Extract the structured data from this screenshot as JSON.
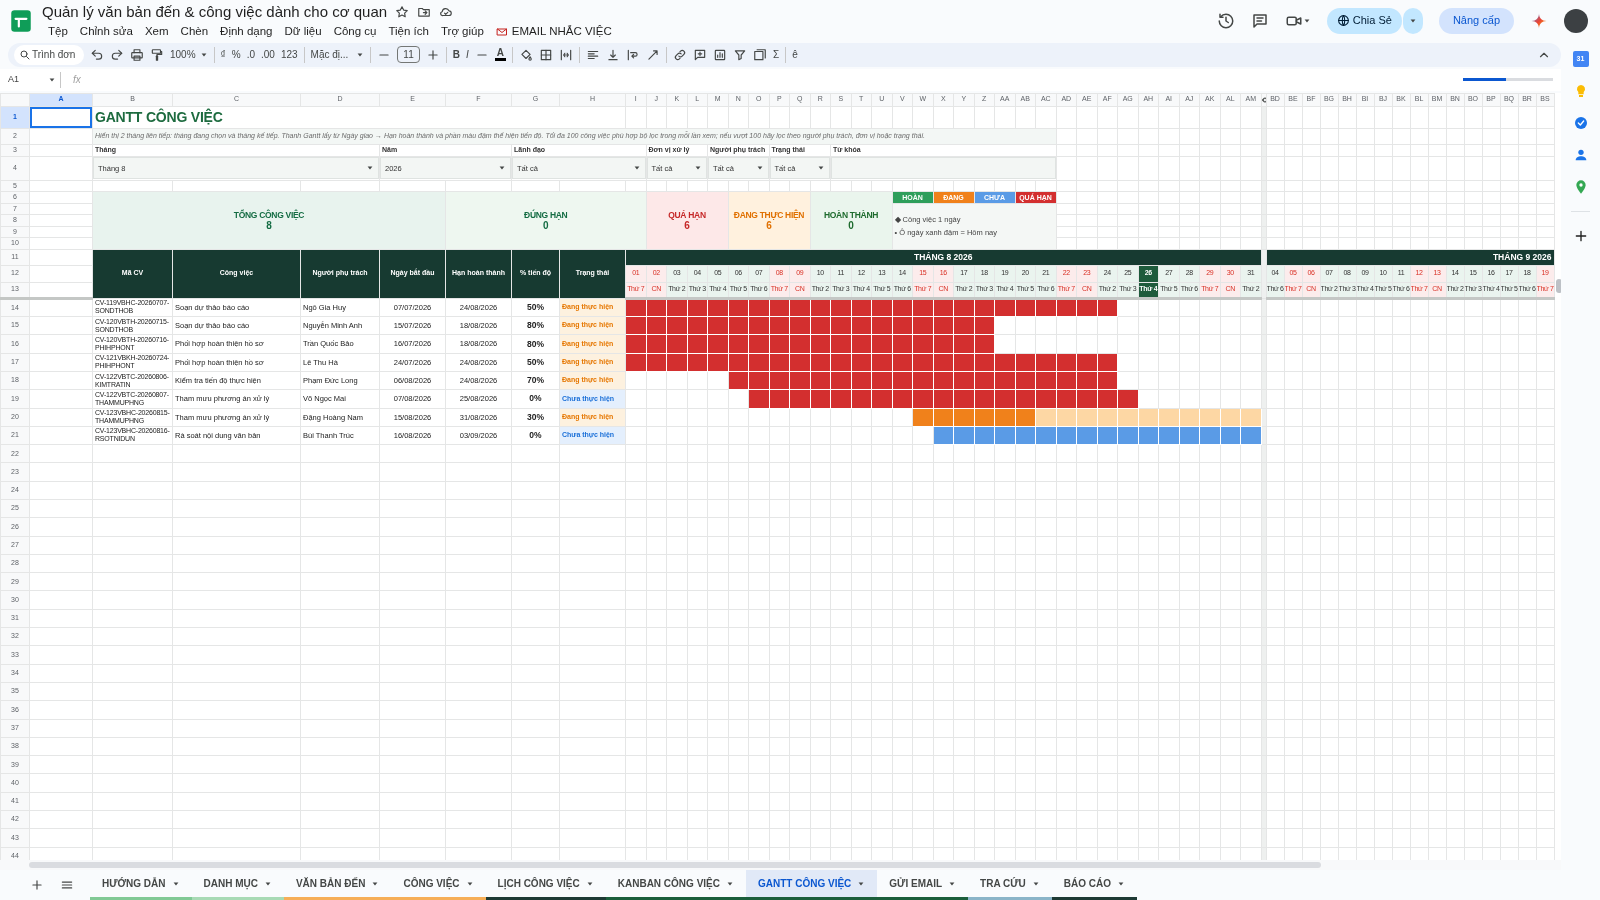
{
  "app": {
    "title": "Quản lý văn bản đến & công việc dành cho cơ quan",
    "share": "Chia Sẻ",
    "upgrade": "Nâng cấp",
    "calendar_badge": "31"
  },
  "menus": [
    {
      "label": "Tệp",
      "kind": "menu"
    },
    {
      "label": "Chỉnh sửa",
      "kind": "menu"
    },
    {
      "label": "Xem",
      "kind": "menu"
    },
    {
      "label": "Chèn",
      "kind": "menu"
    },
    {
      "label": "Định dạng",
      "kind": "menu"
    },
    {
      "label": "Dữ liệu",
      "kind": "menu"
    },
    {
      "label": "Công cụ",
      "kind": "menu"
    },
    {
      "label": "Tiện ích",
      "kind": "menu"
    },
    {
      "label": "Trợ giúp",
      "kind": "menu"
    },
    {
      "label": "EMAIL NHẮC VIỆC",
      "kind": "addon"
    }
  ],
  "toolbar": {
    "search_placeholder": "Trình đơn",
    "zoom": "100%",
    "currency": "₫",
    "percent": "%",
    "decrease_decimal": ".0",
    "increase_decimal": ".00",
    "number_format": "123",
    "font": "Mặc đị...",
    "font_size": "11",
    "bold": "B",
    "italic": "I",
    "text_color": "A",
    "functions": "Σ",
    "input_tools": "ê"
  },
  "formula_bar": {
    "name_box": "A1",
    "formula_label": "fx",
    "loading": {
      "level": 0.48
    }
  },
  "column_letters": [
    {
      "label": "A",
      "selected": true
    },
    {
      "label": "B",
      "selected": false
    },
    {
      "label": "C",
      "selected": false
    },
    {
      "label": "D",
      "selected": false
    },
    {
      "label": "E",
      "selected": false
    },
    {
      "label": "F",
      "selected": false
    },
    {
      "label": "G",
      "selected": false
    },
    {
      "label": "H",
      "selected": false
    },
    {
      "label": "I",
      "selected": false
    },
    {
      "label": "J",
      "selected": false
    },
    {
      "label": "K",
      "selected": false
    },
    {
      "label": "L",
      "selected": false
    },
    {
      "label": "M",
      "selected": false
    },
    {
      "label": "N",
      "selected": false
    },
    {
      "label": "O",
      "selected": false
    },
    {
      "label": "P",
      "selected": false
    },
    {
      "label": "Q",
      "selected": false
    },
    {
      "label": "R",
      "selected": false
    },
    {
      "label": "S",
      "selected": false
    },
    {
      "label": "T",
      "selected": false
    },
    {
      "label": "U",
      "selected": false
    },
    {
      "label": "V",
      "selected": false
    },
    {
      "label": "W",
      "selected": false
    },
    {
      "label": "X",
      "selected": false
    },
    {
      "label": "Y",
      "selected": false
    },
    {
      "label": "Z",
      "selected": false
    },
    {
      "label": "AA",
      "selected": false
    },
    {
      "label": "AB",
      "selected": false
    },
    {
      "label": "AC",
      "selected": false
    },
    {
      "label": "AD",
      "selected": false
    },
    {
      "label": "AE",
      "selected": false
    },
    {
      "label": "AF",
      "selected": false
    },
    {
      "label": "AG",
      "selected": false
    },
    {
      "label": "AH",
      "selected": false
    },
    {
      "label": "AI",
      "selected": false
    },
    {
      "label": "AJ",
      "selected": false
    },
    {
      "label": "AK",
      "selected": false
    },
    {
      "label": "AL",
      "selected": false
    },
    {
      "label": "AM",
      "selected": false
    },
    {
      "label": "BD",
      "selected": false
    },
    {
      "label": "BE",
      "selected": false
    },
    {
      "label": "BF",
      "selected": false
    },
    {
      "label": "BG",
      "selected": false
    },
    {
      "label": "BH",
      "selected": false
    },
    {
      "label": "BI",
      "selected": false
    },
    {
      "label": "BJ",
      "selected": false
    },
    {
      "label": "BK",
      "selected": false
    },
    {
      "label": "BL",
      "selected": false
    },
    {
      "label": "BM",
      "selected": false
    },
    {
      "label": "BN",
      "selected": false
    },
    {
      "label": "BO",
      "selected": false
    },
    {
      "label": "BP",
      "selected": false
    },
    {
      "label": "BQ",
      "selected": false
    },
    {
      "label": "BR",
      "selected": false
    },
    {
      "label": "BS",
      "selected": false
    }
  ],
  "row_numbers": [
    {
      "label": "1",
      "selected": true
    },
    {
      "label": "2",
      "selected": false
    },
    {
      "label": "3",
      "selected": false
    },
    {
      "label": "4",
      "selected": false
    },
    {
      "label": "5",
      "selected": false
    },
    {
      "label": "6",
      "selected": false
    },
    {
      "label": "7",
      "selected": false
    },
    {
      "label": "8",
      "selected": false
    },
    {
      "label": "9",
      "selected": false
    },
    {
      "label": "10",
      "selected": false
    },
    {
      "label": "11",
      "selected": false
    },
    {
      "label": "12",
      "selected": false
    },
    {
      "label": "13",
      "selected": false
    },
    {
      "label": "14",
      "selected": false
    },
    {
      "label": "15",
      "selected": false
    },
    {
      "label": "16",
      "selected": false
    },
    {
      "label": "17",
      "selected": false
    },
    {
      "label": "18",
      "selected": false
    },
    {
      "label": "19",
      "selected": false
    },
    {
      "label": "20",
      "selected": false
    },
    {
      "label": "21",
      "selected": false
    },
    {
      "label": "22",
      "selected": false
    },
    {
      "label": "23",
      "selected": false
    },
    {
      "label": "24",
      "selected": false
    },
    {
      "label": "25",
      "selected": false
    },
    {
      "label": "26",
      "selected": false
    },
    {
      "label": "27",
      "selected": false
    },
    {
      "label": "28",
      "selected": false
    },
    {
      "label": "29",
      "selected": false
    },
    {
      "label": "30",
      "selected": false
    },
    {
      "label": "31",
      "selected": false
    },
    {
      "label": "32",
      "selected": false
    },
    {
      "label": "33",
      "selected": false
    },
    {
      "label": "34",
      "selected": false
    },
    {
      "label": "35",
      "selected": false
    },
    {
      "label": "36",
      "selected": false
    },
    {
      "label": "37",
      "selected": false
    },
    {
      "label": "38",
      "selected": false
    },
    {
      "label": "39",
      "selected": false
    },
    {
      "label": "40",
      "selected": false
    },
    {
      "label": "41",
      "selected": false
    },
    {
      "label": "42",
      "selected": false
    },
    {
      "label": "43",
      "selected": false
    },
    {
      "label": "44",
      "selected": false
    }
  ],
  "sheet": {
    "title": "GANTT CÔNG VIỆC",
    "note": "Hiển thị 2 tháng liên tiếp: tháng đang chọn và tháng kế tiếp. Thanh Gantt lấy từ Ngày giao → Hạn hoàn thành và phần màu đậm thể hiện tiến độ. Tối đa 100 công việc phù hợp bộ lọc trong mỗi lần xem; nếu vượt 100 hãy lọc theo người phụ trách, đơn vị hoặc trạng thái.",
    "filters": [
      {
        "label": "Tháng",
        "value": "Tháng 8"
      },
      {
        "label": "Năm",
        "value": "2026"
      },
      {
        "label": "Lãnh đạo",
        "value": "Tất cả"
      },
      {
        "label": "Đơn vị xử lý",
        "value": "Tất cả"
      },
      {
        "label": "Người phụ trách",
        "value": "Tất cả"
      },
      {
        "label": "Trạng thái",
        "value": "Tất cả"
      },
      {
        "label": "Từ khóa"
      }
    ],
    "stats": [
      {
        "label": "TỔNG CÔNG VIỆC",
        "value": "8",
        "kind": "total"
      },
      {
        "label": "ĐÚNG HẠN",
        "value": "0",
        "kind": "ontime"
      },
      {
        "label": "QUÁ HẠN",
        "value": "6",
        "kind": "late"
      },
      {
        "label": "ĐANG THỰC HIỆN",
        "value": "6",
        "kind": "doing"
      },
      {
        "label": "HOÀN THÀNH",
        "value": "0",
        "kind": "done"
      }
    ],
    "legend": {
      "chips": [
        {
          "label": "HOÀN",
          "color": "#2e9e5b"
        },
        {
          "label": "ĐANG",
          "color": "#f0811b"
        },
        {
          "label": "CHƯA",
          "color": "#5a9be6"
        },
        {
          "label": "QUÁ HẠN",
          "color": "#d32f2f"
        }
      ],
      "notes": [
        "◆ Công việc 1 ngày",
        "•  Ô ngày xanh đậm = Hôm nay"
      ]
    },
    "columns": [
      "Mã CV",
      "Công việc",
      "Người phụ trách",
      "Ngày bắt đầu",
      "Hạn hoàn thành",
      "% tiến độ",
      "Trạng thái"
    ],
    "months": [
      {
        "title": "THÁNG 8 2026",
        "days": [
          {
            "day": "01",
            "weekday": "Thứ 7",
            "weekend": true,
            "today": false
          },
          {
            "day": "02",
            "weekday": "CN",
            "weekend": true,
            "today": false
          },
          {
            "day": "03",
            "weekday": "Thứ 2",
            "weekend": false,
            "today": false
          },
          {
            "day": "04",
            "weekday": "Thứ 3",
            "weekend": false,
            "today": false
          },
          {
            "day": "05",
            "weekday": "Thứ 4",
            "weekend": false,
            "today": false
          },
          {
            "day": "06",
            "weekday": "Thứ 5",
            "weekend": false,
            "today": false
          },
          {
            "day": "07",
            "weekday": "Thứ 6",
            "weekend": false,
            "today": false
          },
          {
            "day": "08",
            "weekday": "Thứ 7",
            "weekend": true,
            "today": false
          },
          {
            "day": "09",
            "weekday": "CN",
            "weekend": true,
            "today": false
          },
          {
            "day": "10",
            "weekday": "Thứ 2",
            "weekend": false,
            "today": false
          },
          {
            "day": "11",
            "weekday": "Thứ 3",
            "weekend": false,
            "today": false
          },
          {
            "day": "12",
            "weekday": "Thứ 4",
            "weekend": false,
            "today": false
          },
          {
            "day": "13",
            "weekday": "Thứ 5",
            "weekend": false,
            "today": false
          },
          {
            "day": "14",
            "weekday": "Thứ 6",
            "weekend": false,
            "today": false
          },
          {
            "day": "15",
            "weekday": "Thứ 7",
            "weekend": true,
            "today": false
          },
          {
            "day": "16",
            "weekday": "CN",
            "weekend": true,
            "today": false
          },
          {
            "day": "17",
            "weekday": "Thứ 2",
            "weekend": false,
            "today": false
          },
          {
            "day": "18",
            "weekday": "Thứ 3",
            "weekend": false,
            "today": false
          },
          {
            "day": "19",
            "weekday": "Thứ 4",
            "weekend": false,
            "today": false
          },
          {
            "day": "20",
            "weekday": "Thứ 5",
            "weekend": false,
            "today": false
          },
          {
            "day": "21",
            "weekday": "Thứ 6",
            "weekend": false,
            "today": false
          },
          {
            "day": "22",
            "weekday": "Thứ 7",
            "weekend": true,
            "today": false
          },
          {
            "day": "23",
            "weekday": "CN",
            "weekend": true,
            "today": false
          },
          {
            "day": "24",
            "weekday": "Thứ 2",
            "weekend": false,
            "today": false
          },
          {
            "day": "25",
            "weekday": "Thứ 3",
            "weekend": false,
            "today": false
          },
          {
            "day": "26",
            "weekday": "Thứ 4",
            "weekend": false,
            "today": true
          },
          {
            "day": "27",
            "weekday": "Thứ 5",
            "weekend": false,
            "today": false
          },
          {
            "day": "28",
            "weekday": "Thứ 6",
            "weekend": false,
            "today": false
          },
          {
            "day": "29",
            "weekday": "Thứ 7",
            "weekend": true,
            "today": false
          },
          {
            "day": "30",
            "weekday": "CN",
            "weekend": true,
            "today": false
          },
          {
            "day": "31",
            "weekday": "Thứ 2",
            "weekend": false,
            "today": false
          }
        ]
      },
      {
        "title": "THÁNG 9 2026",
        "days": [
          {
            "day": "04",
            "weekday": "Thứ 6",
            "weekend": false,
            "today": false
          },
          {
            "day": "05",
            "weekday": "Thứ 7",
            "weekend": true,
            "today": false
          },
          {
            "day": "06",
            "weekday": "CN",
            "weekend": true,
            "today": false
          },
          {
            "day": "07",
            "weekday": "Thứ 2",
            "weekend": false,
            "today": false
          },
          {
            "day": "08",
            "weekday": "Thứ 3",
            "weekend": false,
            "today": false
          },
          {
            "day": "09",
            "weekday": "Thứ 4",
            "weekend": false,
            "today": false
          },
          {
            "day": "10",
            "weekday": "Thứ 5",
            "weekend": false,
            "today": false
          },
          {
            "day": "11",
            "weekday": "Thứ 6",
            "weekend": false,
            "today": false
          },
          {
            "day": "12",
            "weekday": "Thứ 7",
            "weekend": true,
            "today": false
          },
          {
            "day": "13",
            "weekday": "CN",
            "weekend": true,
            "today": false
          },
          {
            "day": "14",
            "weekday": "Thứ 2",
            "weekend": false,
            "today": false
          },
          {
            "day": "15",
            "weekday": "Thứ 3",
            "weekend": false,
            "today": false
          },
          {
            "day": "16",
            "weekday": "Thứ 4",
            "weekend": false,
            "today": false
          },
          {
            "day": "17",
            "weekday": "Thứ 5",
            "weekend": false,
            "today": false
          },
          {
            "day": "18",
            "weekday": "Thứ 6",
            "weekend": false,
            "today": false
          },
          {
            "day": "19",
            "weekday": "Thứ 7",
            "weekend": true,
            "today": false
          }
        ]
      }
    ],
    "tasks": [
      {
        "code": "CV-119VBHC-20260707-SONDTHOB",
        "name": "Soạn dự thảo báo cáo",
        "owner": "Ngô Gia Huy",
        "start": "07/07/2026",
        "due": "24/08/2026",
        "progress": "50%",
        "status": "Đang thực hiện",
        "kind": "doing",
        "cells": [
          {
            "kind": "late"
          },
          {
            "kind": "late"
          },
          {
            "kind": "late"
          },
          {
            "kind": "late"
          },
          {
            "kind": "late"
          },
          {
            "kind": "late"
          },
          {
            "kind": "late"
          },
          {
            "kind": "late"
          },
          {
            "kind": "late"
          },
          {
            "kind": "late"
          },
          {
            "kind": "late"
          },
          {
            "kind": "late"
          },
          {
            "kind": "late"
          },
          {
            "kind": "late"
          },
          {
            "kind": "late"
          },
          {
            "kind": "late"
          },
          {
            "kind": "late"
          },
          {
            "kind": "late"
          },
          {
            "kind": "late"
          },
          {
            "kind": "late"
          },
          {
            "kind": "late"
          },
          {
            "kind": "late"
          },
          {
            "kind": "late"
          },
          {
            "kind": "late"
          },
          {
            "kind": "none"
          },
          {
            "kind": "none"
          },
          {
            "kind": "none"
          },
          {
            "kind": "none"
          },
          {
            "kind": "none"
          },
          {
            "kind": "none"
          },
          {
            "kind": "none"
          }
        ]
      },
      {
        "code": "CV-120VBTH-20260715-SONDTHOB",
        "name": "Soạn dự thảo báo cáo",
        "owner": "Nguyễn Minh Anh",
        "start": "15/07/2026",
        "due": "18/08/2026",
        "progress": "80%",
        "status": "Đang thực hiện",
        "kind": "doing",
        "cells": [
          {
            "kind": "late"
          },
          {
            "kind": "late"
          },
          {
            "kind": "late"
          },
          {
            "kind": "late"
          },
          {
            "kind": "late"
          },
          {
            "kind": "late"
          },
          {
            "kind": "late"
          },
          {
            "kind": "late"
          },
          {
            "kind": "late"
          },
          {
            "kind": "late"
          },
          {
            "kind": "late"
          },
          {
            "kind": "late"
          },
          {
            "kind": "late"
          },
          {
            "kind": "late"
          },
          {
            "kind": "late"
          },
          {
            "kind": "late"
          },
          {
            "kind": "late"
          },
          {
            "kind": "late"
          },
          {
            "kind": "none"
          },
          {
            "kind": "none"
          },
          {
            "kind": "none"
          },
          {
            "kind": "none"
          },
          {
            "kind": "none"
          },
          {
            "kind": "none"
          },
          {
            "kind": "none"
          },
          {
            "kind": "none"
          },
          {
            "kind": "none"
          },
          {
            "kind": "none"
          },
          {
            "kind": "none"
          },
          {
            "kind": "none"
          },
          {
            "kind": "none"
          }
        ]
      },
      {
        "code": "CV-120VBTH-20260716-PHIHPHONT",
        "name": "Phối hợp hoàn thiện hồ sơ",
        "owner": "Trần Quốc Bảo",
        "start": "16/07/2026",
        "due": "18/08/2026",
        "progress": "80%",
        "status": "Đang thực hiện",
        "kind": "doing",
        "cells": [
          {
            "kind": "late"
          },
          {
            "kind": "late"
          },
          {
            "kind": "late"
          },
          {
            "kind": "late"
          },
          {
            "kind": "late"
          },
          {
            "kind": "late"
          },
          {
            "kind": "late"
          },
          {
            "kind": "late"
          },
          {
            "kind": "late"
          },
          {
            "kind": "late"
          },
          {
            "kind": "late"
          },
          {
            "kind": "late"
          },
          {
            "kind": "late"
          },
          {
            "kind": "late"
          },
          {
            "kind": "late"
          },
          {
            "kind": "late"
          },
          {
            "kind": "late"
          },
          {
            "kind": "late"
          },
          {
            "kind": "none"
          },
          {
            "kind": "none"
          },
          {
            "kind": "none"
          },
          {
            "kind": "none"
          },
          {
            "kind": "none"
          },
          {
            "kind": "none"
          },
          {
            "kind": "none"
          },
          {
            "kind": "none"
          },
          {
            "kind": "none"
          },
          {
            "kind": "none"
          },
          {
            "kind": "none"
          },
          {
            "kind": "none"
          },
          {
            "kind": "none"
          }
        ]
      },
      {
        "code": "CV-121VBKH-20260724-PHIHPHONT",
        "name": "Phối hợp hoàn thiện hồ sơ",
        "owner": "Lê Thu Hà",
        "start": "24/07/2026",
        "due": "24/08/2026",
        "progress": "50%",
        "status": "Đang thực hiện",
        "kind": "doing",
        "cells": [
          {
            "kind": "late"
          },
          {
            "kind": "late"
          },
          {
            "kind": "late"
          },
          {
            "kind": "late"
          },
          {
            "kind": "late"
          },
          {
            "kind": "late"
          },
          {
            "kind": "late"
          },
          {
            "kind": "late"
          },
          {
            "kind": "late"
          },
          {
            "kind": "late"
          },
          {
            "kind": "late"
          },
          {
            "kind": "late"
          },
          {
            "kind": "late"
          },
          {
            "kind": "late"
          },
          {
            "kind": "late"
          },
          {
            "kind": "late"
          },
          {
            "kind": "late"
          },
          {
            "kind": "late"
          },
          {
            "kind": "late"
          },
          {
            "kind": "late"
          },
          {
            "kind": "late"
          },
          {
            "kind": "late"
          },
          {
            "kind": "late"
          },
          {
            "kind": "late"
          },
          {
            "kind": "none"
          },
          {
            "kind": "none"
          },
          {
            "kind": "none"
          },
          {
            "kind": "none"
          },
          {
            "kind": "none"
          },
          {
            "kind": "none"
          },
          {
            "kind": "none"
          }
        ]
      },
      {
        "code": "CV-122VBTC-20260806-KIMTRATIN",
        "name": "Kiểm tra tiến độ thực hiện",
        "owner": "Phạm Đức Long",
        "start": "06/08/2026",
        "due": "24/08/2026",
        "progress": "70%",
        "status": "Đang thực hiện",
        "kind": "doing",
        "cells": [
          {
            "kind": "none"
          },
          {
            "kind": "none"
          },
          {
            "kind": "none"
          },
          {
            "kind": "none"
          },
          {
            "kind": "none"
          },
          {
            "kind": "late"
          },
          {
            "kind": "late"
          },
          {
            "kind": "late"
          },
          {
            "kind": "late"
          },
          {
            "kind": "late"
          },
          {
            "kind": "late"
          },
          {
            "kind": "late"
          },
          {
            "kind": "late"
          },
          {
            "kind": "late"
          },
          {
            "kind": "late"
          },
          {
            "kind": "late"
          },
          {
            "kind": "late"
          },
          {
            "kind": "late"
          },
          {
            "kind": "late"
          },
          {
            "kind": "late"
          },
          {
            "kind": "late"
          },
          {
            "kind": "late"
          },
          {
            "kind": "late"
          },
          {
            "kind": "late"
          },
          {
            "kind": "none"
          },
          {
            "kind": "none"
          },
          {
            "kind": "none"
          },
          {
            "kind": "none"
          },
          {
            "kind": "none"
          },
          {
            "kind": "none"
          },
          {
            "kind": "none"
          }
        ]
      },
      {
        "code": "CV-122VBTC-20260807-THAMMUPHNG",
        "name": "Tham mưu phương án xử lý",
        "owner": "Võ Ngọc Mai",
        "start": "07/08/2026",
        "due": "25/08/2026",
        "progress": "0%",
        "status": "Chưa thực hiện",
        "kind": "todo",
        "cells": [
          {
            "kind": "none"
          },
          {
            "kind": "none"
          },
          {
            "kind": "none"
          },
          {
            "kind": "none"
          },
          {
            "kind": "none"
          },
          {
            "kind": "none"
          },
          {
            "kind": "late"
          },
          {
            "kind": "late"
          },
          {
            "kind": "late"
          },
          {
            "kind": "late"
          },
          {
            "kind": "late"
          },
          {
            "kind": "late"
          },
          {
            "kind": "late"
          },
          {
            "kind": "late"
          },
          {
            "kind": "late"
          },
          {
            "kind": "late"
          },
          {
            "kind": "late"
          },
          {
            "kind": "late"
          },
          {
            "kind": "late"
          },
          {
            "kind": "late"
          },
          {
            "kind": "late"
          },
          {
            "kind": "late"
          },
          {
            "kind": "late"
          },
          {
            "kind": "late"
          },
          {
            "kind": "late"
          },
          {
            "kind": "none"
          },
          {
            "kind": "none"
          },
          {
            "kind": "none"
          },
          {
            "kind": "none"
          },
          {
            "kind": "none"
          },
          {
            "kind": "none"
          }
        ]
      },
      {
        "code": "CV-123VBHC-20260815-THAMMUPHNG",
        "name": "Tham mưu phương án xử lý",
        "owner": "Đặng Hoàng Nam",
        "start": "15/08/2026",
        "due": "31/08/2026",
        "progress": "30%",
        "status": "Đang thực hiện",
        "kind": "doing",
        "cells": [
          {
            "kind": "none"
          },
          {
            "kind": "none"
          },
          {
            "kind": "none"
          },
          {
            "kind": "none"
          },
          {
            "kind": "none"
          },
          {
            "kind": "none"
          },
          {
            "kind": "none"
          },
          {
            "kind": "none"
          },
          {
            "kind": "none"
          },
          {
            "kind": "none"
          },
          {
            "kind": "none"
          },
          {
            "kind": "none"
          },
          {
            "kind": "none"
          },
          {
            "kind": "none"
          },
          {
            "kind": "done"
          },
          {
            "kind": "done"
          },
          {
            "kind": "done"
          },
          {
            "kind": "done"
          },
          {
            "kind": "done"
          },
          {
            "kind": "done"
          },
          {
            "kind": "rest"
          },
          {
            "kind": "rest"
          },
          {
            "kind": "rest"
          },
          {
            "kind": "rest"
          },
          {
            "kind": "rest"
          },
          {
            "kind": "rest"
          },
          {
            "kind": "rest"
          },
          {
            "kind": "rest"
          },
          {
            "kind": "rest"
          },
          {
            "kind": "rest"
          },
          {
            "kind": "rest"
          }
        ]
      },
      {
        "code": "CV-123VBHC-20260816-RSOTNIDUN",
        "name": "Rà soát nội dung văn bản",
        "owner": "Bùi Thanh Trúc",
        "start": "16/08/2026",
        "due": "03/09/2026",
        "progress": "0%",
        "status": "Chưa thực hiện",
        "kind": "todo",
        "cells": [
          {
            "kind": "none"
          },
          {
            "kind": "none"
          },
          {
            "kind": "none"
          },
          {
            "kind": "none"
          },
          {
            "kind": "none"
          },
          {
            "kind": "none"
          },
          {
            "kind": "none"
          },
          {
            "kind": "none"
          },
          {
            "kind": "none"
          },
          {
            "kind": "none"
          },
          {
            "kind": "none"
          },
          {
            "kind": "none"
          },
          {
            "kind": "none"
          },
          {
            "kind": "none"
          },
          {
            "kind": "none"
          },
          {
            "kind": "plan"
          },
          {
            "kind": "plan"
          },
          {
            "kind": "plan"
          },
          {
            "kind": "plan"
          },
          {
            "kind": "plan"
          },
          {
            "kind": "plan"
          },
          {
            "kind": "plan"
          },
          {
            "kind": "plan"
          },
          {
            "kind": "plan"
          },
          {
            "kind": "plan"
          },
          {
            "kind": "plan"
          },
          {
            "kind": "plan"
          },
          {
            "kind": "plan"
          },
          {
            "kind": "plan"
          },
          {
            "kind": "plan"
          },
          {
            "kind": "plan"
          }
        ]
      }
    ]
  },
  "tabs": [
    {
      "label": "HƯỚNG DẪN",
      "color": "#81c995",
      "selected": false
    },
    {
      "label": "DANH MỤC",
      "color": "#a8dab5",
      "selected": false
    },
    {
      "label": "VĂN BẢN ĐẾN",
      "color": "#f6ae57",
      "selected": false
    },
    {
      "label": "CÔNG VIỆC",
      "color": "#f6ae57",
      "selected": false
    },
    {
      "label": "LỊCH CÔNG VIỆC",
      "color": "#1e3a34",
      "selected": false
    },
    {
      "label": "KANBAN CÔNG VIỆC",
      "color": "#1b5e3b",
      "selected": false
    },
    {
      "label": "GANTT CÔNG VIỆC",
      "color": "#1b5e3b",
      "selected": true
    },
    {
      "label": "GỬI EMAIL",
      "color": "#1b5e3b",
      "selected": false
    },
    {
      "label": "TRA CỨU",
      "color": "#8ab4c8",
      "selected": false
    },
    {
      "label": "BÁO CÁO",
      "color": "#1e3a34",
      "selected": false
    }
  ]
}
